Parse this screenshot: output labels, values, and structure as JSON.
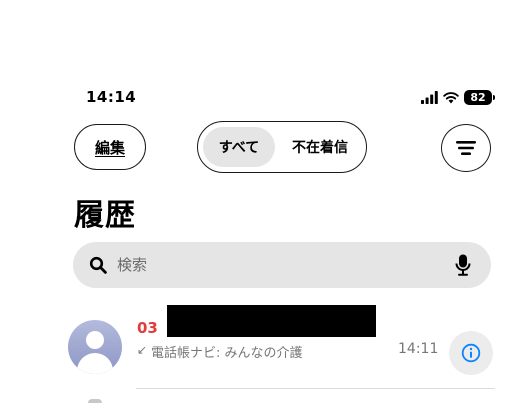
{
  "status_bar": {
    "time": "14:14",
    "battery_level": "82",
    "icons": [
      "cellular-signal-icon",
      "wifi-icon",
      "battery-icon"
    ]
  },
  "toolbar": {
    "edit_label": "編集",
    "segments": [
      "すべて",
      "不在着信"
    ],
    "selected_segment": "すべて",
    "menu_icon": "hamburger-menu-icon"
  },
  "page": {
    "title": "履歴"
  },
  "search": {
    "placeholder": "検索",
    "value": "",
    "icons": [
      "search-icon",
      "microphone-icon"
    ]
  },
  "calls": [
    {
      "number": "03",
      "subtitle": "電話帳ナビ: みんなの介護",
      "time": "14:11",
      "missed": true,
      "call_type_icon": "↙",
      "number_color": "#e23b3b"
    }
  ],
  "colors": {
    "accent": "#0a84ff",
    "missed": "#e23b3b",
    "secondary_text": "#777777",
    "segment_selected": "#e5e5e5"
  }
}
